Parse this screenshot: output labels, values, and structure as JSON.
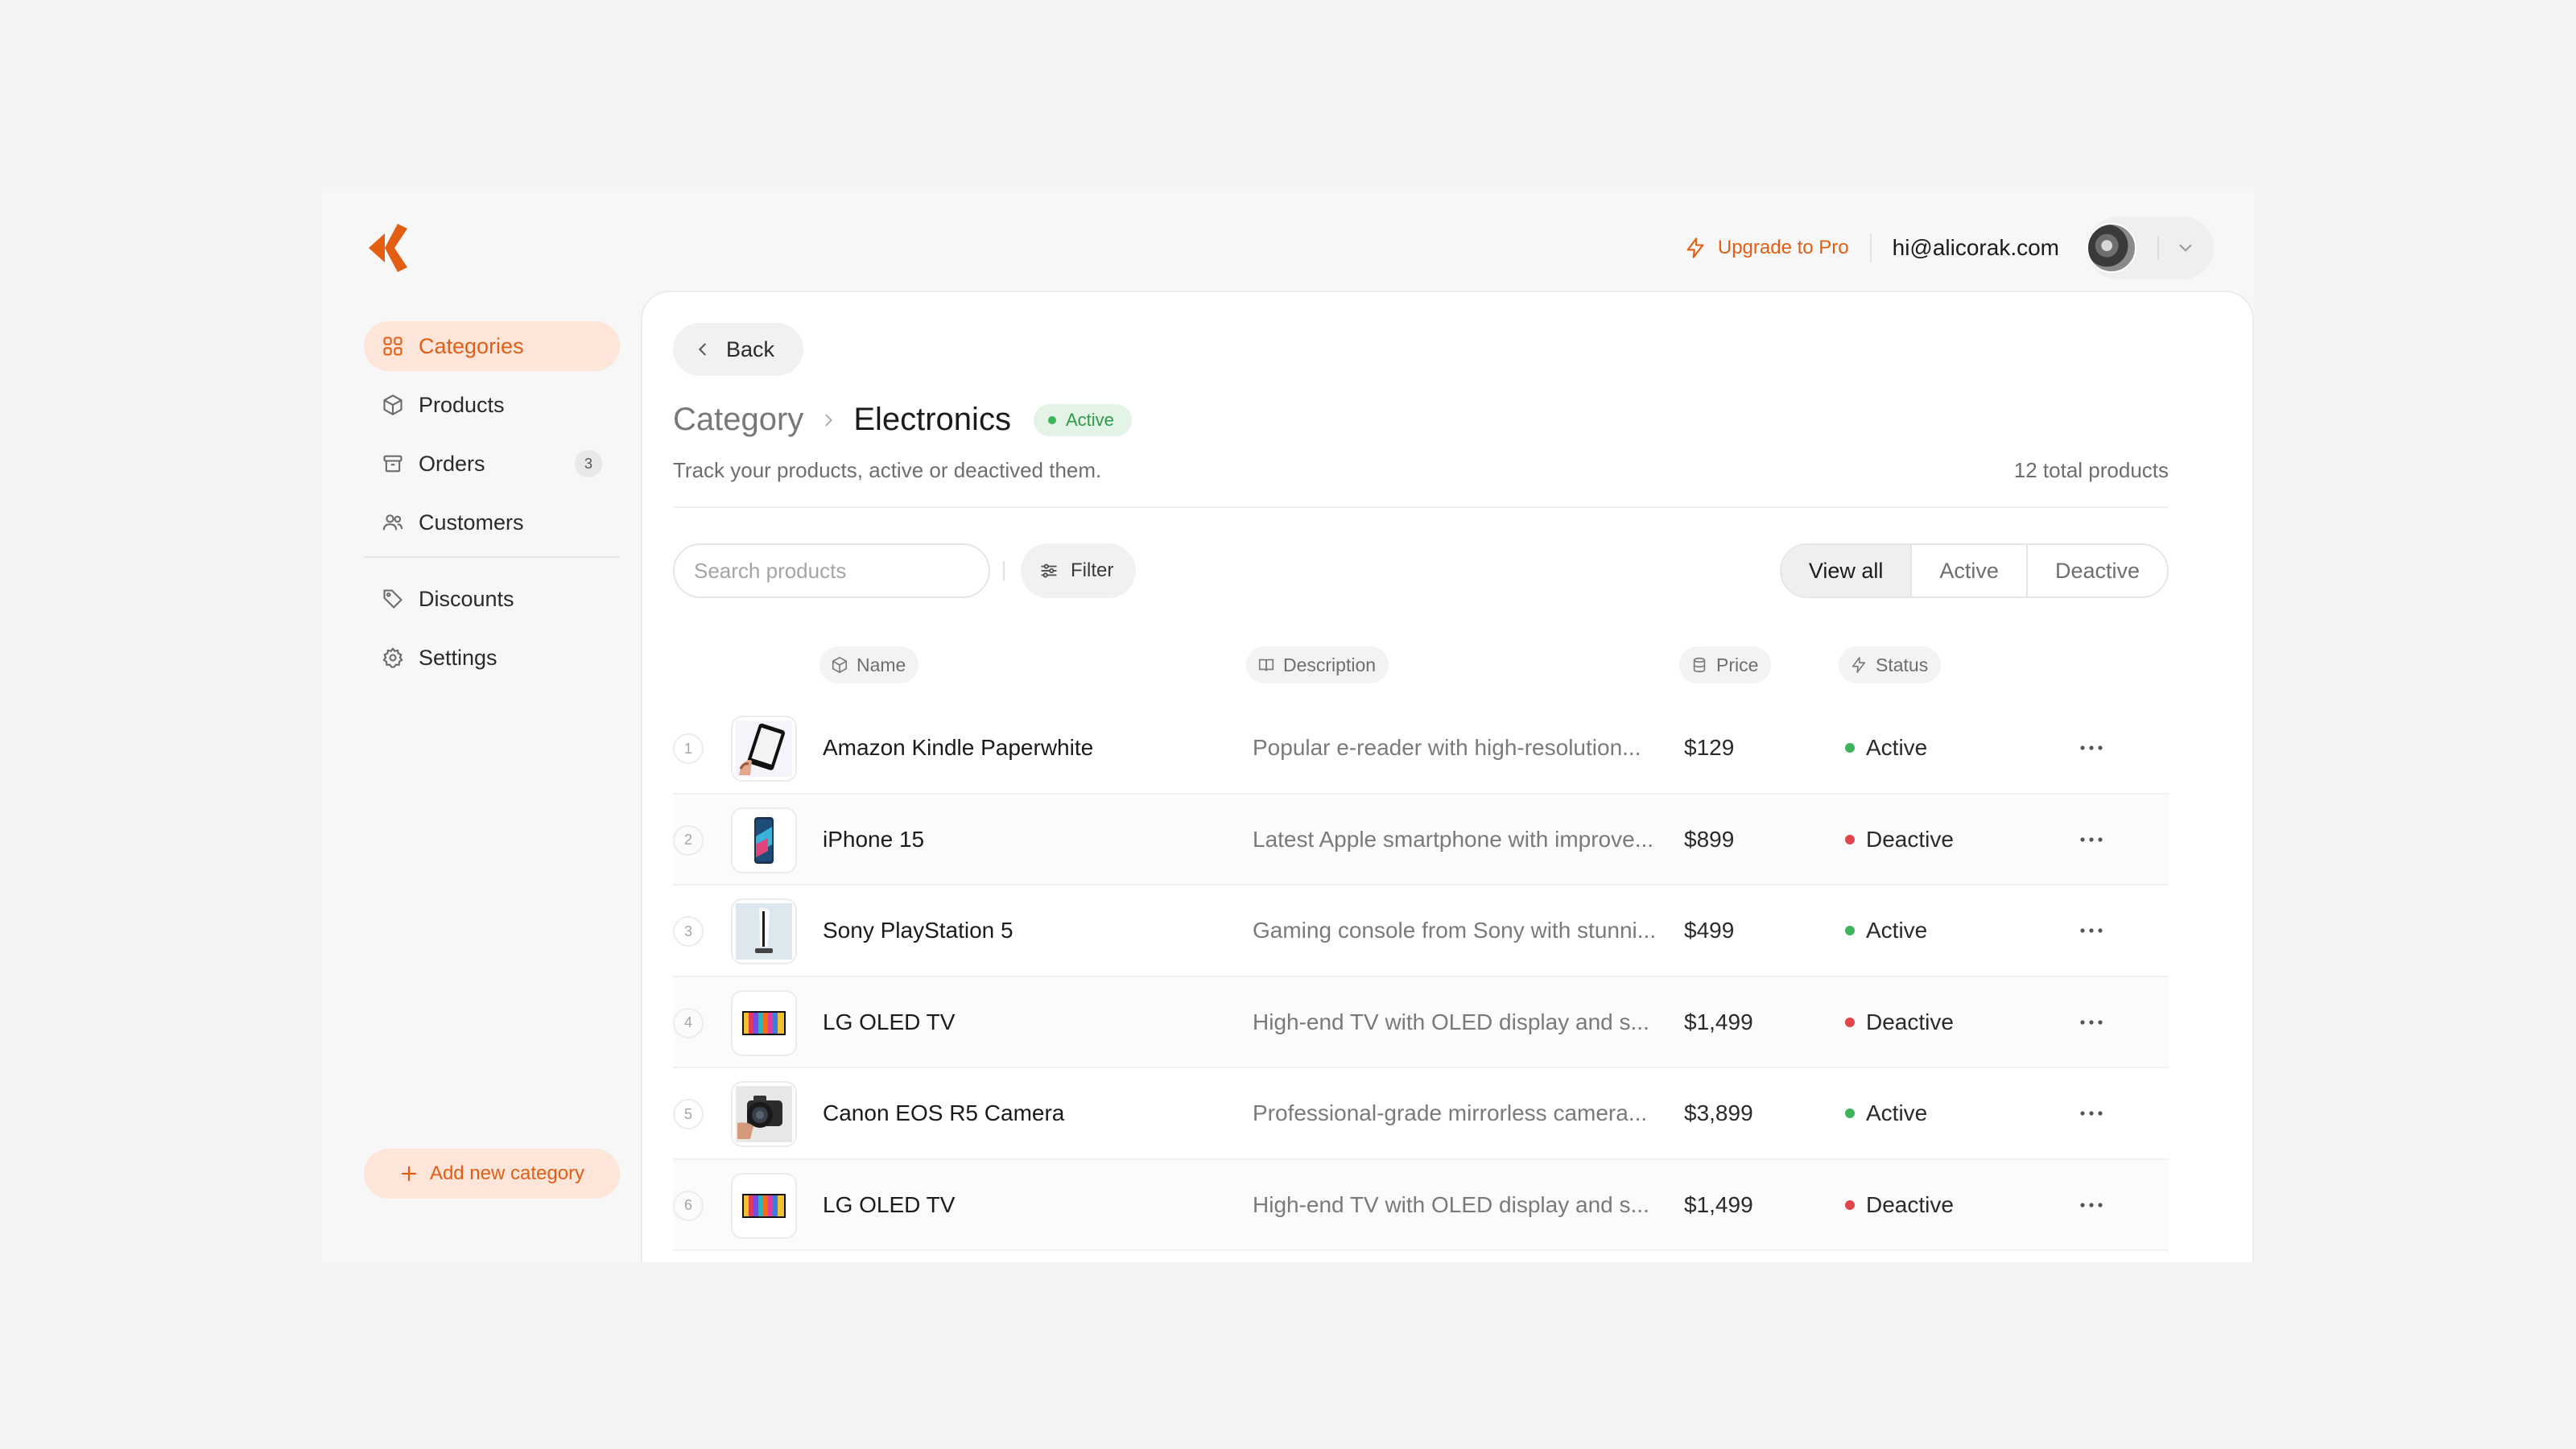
{
  "topbar": {
    "upgrade_label": "Upgrade to Pro",
    "email": "hi@alicorak.com"
  },
  "sidebar": {
    "items": [
      {
        "label": "Categories",
        "icon": "grid-icon",
        "active": true
      },
      {
        "label": "Products",
        "icon": "box-icon"
      },
      {
        "label": "Orders",
        "icon": "archive-icon",
        "count": "3"
      },
      {
        "label": "Customers",
        "icon": "users-icon"
      },
      {
        "label": "Discounts",
        "icon": "tag-icon"
      },
      {
        "label": "Settings",
        "icon": "gear-icon"
      }
    ],
    "add_label": "Add new category"
  },
  "main": {
    "back_label": "Back",
    "breadcrumb_root": "Category",
    "breadcrumb_current": "Electronics",
    "badge": "Active",
    "subtitle": "Track your products, active or deactived them.",
    "total": "12 total products",
    "search_placeholder": "Search products",
    "filter_label": "Filter",
    "segments": [
      "View all",
      "Active",
      "Deactive"
    ],
    "selected_segment": "View all",
    "columns": {
      "name": "Name",
      "description": "Description",
      "price": "Price",
      "status": "Status"
    },
    "rows": [
      {
        "index": "1",
        "name": "Amazon Kindle Paperwhite",
        "description": "Popular e-reader with high-resolution...",
        "price": "$129",
        "status": "Active",
        "thumb": "kindle"
      },
      {
        "index": "2",
        "name": "iPhone 15",
        "description": "Latest Apple smartphone with improve...",
        "price": "$899",
        "status": "Deactive",
        "thumb": "phone"
      },
      {
        "index": "3",
        "name": "Sony PlayStation 5",
        "description": "Gaming console from Sony with stunni...",
        "price": "$499",
        "status": "Active",
        "thumb": "console"
      },
      {
        "index": "4",
        "name": "LG OLED TV",
        "description": "High-end TV with OLED display and s...",
        "price": "$1,499",
        "status": "Deactive",
        "thumb": "tv"
      },
      {
        "index": "5",
        "name": "Canon EOS R5 Camera",
        "description": "Professional-grade mirrorless camera...",
        "price": "$3,899",
        "status": "Active",
        "thumb": "camera"
      },
      {
        "index": "6",
        "name": "LG OLED TV",
        "description": "High-end TV with OLED display and s...",
        "price": "$1,499",
        "status": "Deactive",
        "thumb": "tv"
      }
    ]
  },
  "colors": {
    "accent": "#e35d12",
    "active_dot": "#3db45a",
    "deactive_dot": "#e0454b"
  }
}
